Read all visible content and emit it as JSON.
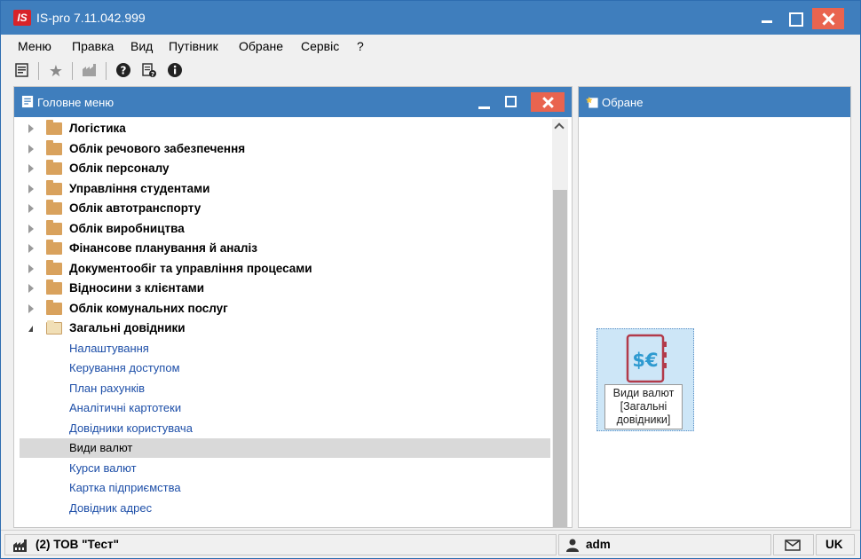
{
  "window": {
    "logo": "IS",
    "title": "IS-pro 7.11.042.999"
  },
  "menu": [
    "Меню",
    "Правка",
    "Вид",
    "Путівник",
    "Обране",
    "Сервіс",
    "?"
  ],
  "left_panel": {
    "title": "Головне меню",
    "tree": [
      {
        "label": "Логістика",
        "type": "folder"
      },
      {
        "label": "Облік речового забезпечення",
        "type": "folder"
      },
      {
        "label": "Облік персоналу",
        "type": "folder"
      },
      {
        "label": "Управління студентами",
        "type": "folder"
      },
      {
        "label": "Облік автотранспорту",
        "type": "folder"
      },
      {
        "label": "Облік виробництва",
        "type": "folder"
      },
      {
        "label": "Фінансове планування й аналіз",
        "type": "folder"
      },
      {
        "label": "Документообіг та управління процесами",
        "type": "folder"
      },
      {
        "label": "Відносини з клієнтами",
        "type": "folder"
      },
      {
        "label": "Облік комунальних послуг",
        "type": "folder"
      },
      {
        "label": "Загальні довідники",
        "type": "open-folder"
      },
      {
        "label": "Налаштування",
        "type": "item"
      },
      {
        "label": "Керування доступом",
        "type": "item"
      },
      {
        "label": "План рахунків",
        "type": "item"
      },
      {
        "label": "Аналітичні картотеки",
        "type": "item"
      },
      {
        "label": "Довідники користувача",
        "type": "item"
      },
      {
        "label": "Види валют",
        "type": "item",
        "selected": true
      },
      {
        "label": "Курси валют",
        "type": "item"
      },
      {
        "label": "Картка підприємства",
        "type": "item"
      },
      {
        "label": "Довідник адрес",
        "type": "item"
      }
    ]
  },
  "right_panel": {
    "title": "Обране",
    "favorite": {
      "line1": "Види валют",
      "line2": "[Загальні",
      "line3": "довідники]"
    }
  },
  "status": {
    "company": "(2) ТОВ \"Тест\"",
    "user": "adm",
    "lang": "UK"
  },
  "colors": {
    "titlebar": "#3f7ebd",
    "close": "#e9644f",
    "link": "#1e4fa8"
  }
}
